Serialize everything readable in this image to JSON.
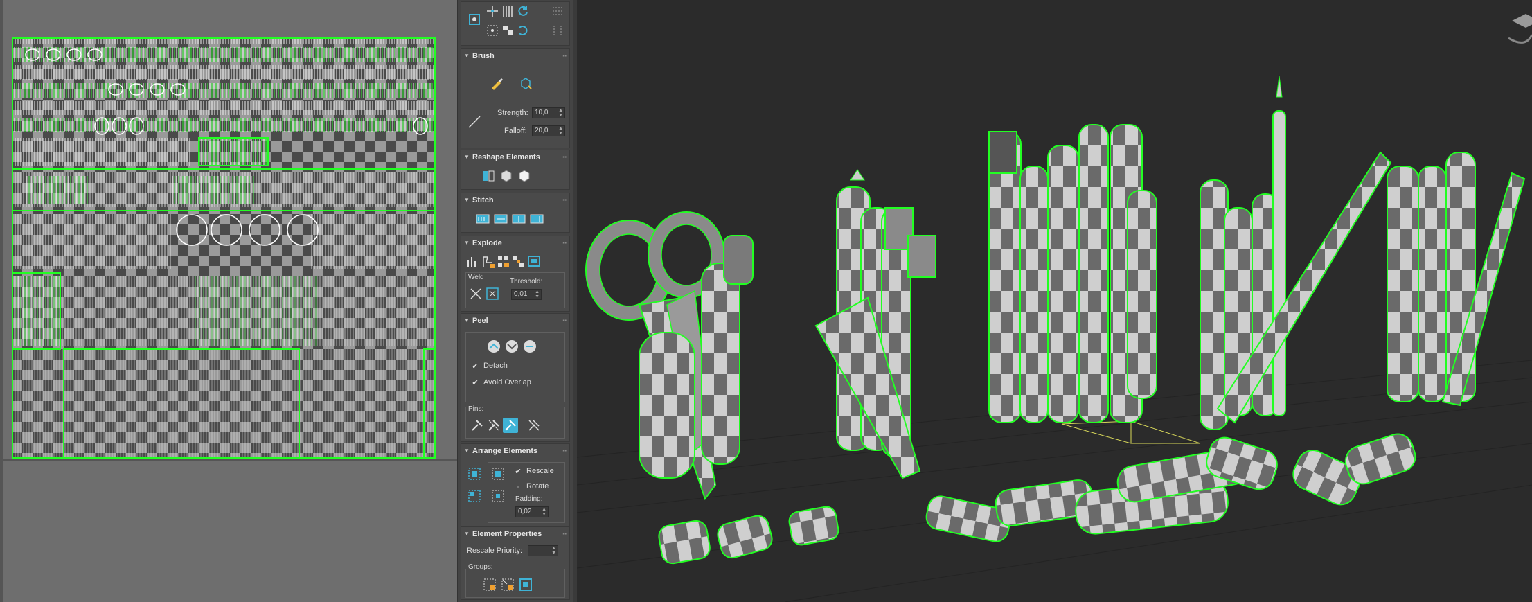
{
  "brush": {
    "title": "Brush",
    "strength_label": "Strength:",
    "strength_value": "10,0",
    "falloff_label": "Falloff:",
    "falloff_value": "20,0"
  },
  "reshape": {
    "title": "Reshape Elements"
  },
  "stitch": {
    "title": "Stitch"
  },
  "explode": {
    "title": "Explode",
    "weld_label": "Weld",
    "threshold_label": "Threshold:",
    "threshold_value": "0,01"
  },
  "peel": {
    "title": "Peel",
    "detach_label": "Detach",
    "avoid_overlap_label": "Avoid Overlap",
    "pins_label": "Pins:"
  },
  "arrange": {
    "title": "Arrange Elements",
    "rescale_label": "Rescale",
    "rotate_label": "Rotate",
    "padding_label": "Padding:",
    "padding_value": "0,02"
  },
  "element_props": {
    "title": "Element Properties",
    "rescale_priority_label": "Rescale Priority:",
    "groups_label": "Groups:"
  },
  "colors": {
    "uv_seam": "#22ff22",
    "checker_light": "#d9d9d9",
    "checker_dark": "#555555",
    "panel_bg": "#444444",
    "accent_blue": "#3fb3d6"
  }
}
